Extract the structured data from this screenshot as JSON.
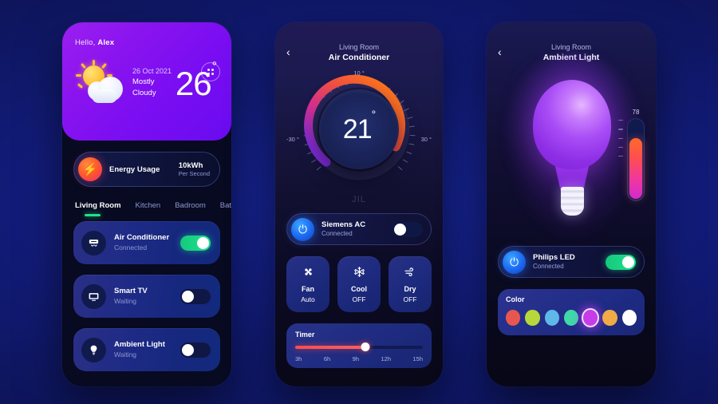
{
  "theme": {
    "background": "#121c7a",
    "accent_green": "#1fe08e",
    "accent_purple": "#8a14ef",
    "accent_blue": "#1e6ff5",
    "accent_red": "#ff4d4d"
  },
  "screen1": {
    "greeting_prefix": "Hello, ",
    "greeting_name": "Alex",
    "grid_button": "grid-menu",
    "weather": {
      "date": "26 Oct 2021",
      "condition_line1": "Mostly",
      "condition_line2": "Cloudy",
      "temperature": "26",
      "degree": "°",
      "icon": "sun-behind-cloud-icon"
    },
    "energy": {
      "label": "Energy Usage",
      "value": "10kWh",
      "unit": "Per Second",
      "icon": "bolt-icon"
    },
    "tabs": [
      {
        "label": "Living Room",
        "active": true
      },
      {
        "label": "Kitchen",
        "active": false
      },
      {
        "label": "Badroom",
        "active": false
      },
      {
        "label": "Bath",
        "active": false
      }
    ],
    "devices": [
      {
        "name": "Air Conditioner",
        "status": "Connected",
        "icon": "air-conditioner-icon",
        "toggle": "on"
      },
      {
        "name": "Smart TV",
        "status": "Waiting",
        "icon": "television-icon",
        "toggle": "off"
      },
      {
        "name": "Ambient Light",
        "status": "Waiting",
        "icon": "lightbulb-icon",
        "toggle": "off"
      }
    ]
  },
  "screen2": {
    "back": "‹",
    "room": "Living Room",
    "device": "Air Conditioner",
    "thermostat": {
      "top_label": "10 °",
      "left_label": "-30 °",
      "right_label": "30 °",
      "value": "21",
      "degree": "°",
      "brand": "JIL"
    },
    "power_card": {
      "name": "Siemens AC",
      "status": "Connected",
      "icon": "power-icon",
      "toggle": "off"
    },
    "modes": [
      {
        "label": "Fan",
        "value": "Auto",
        "icon": "fan-icon",
        "glyph": "✻",
        "active": true
      },
      {
        "label": "Cool",
        "value": "OFF",
        "icon": "snowflake-icon",
        "glyph": "❄",
        "active": false
      },
      {
        "label": "Dry",
        "value": "OFF",
        "icon": "wind-icon",
        "glyph": "⟿",
        "active": false
      }
    ],
    "timer": {
      "title": "Timer",
      "ticks": [
        "3h",
        "6h",
        "9h",
        "12h",
        "15h"
      ],
      "value_percent": 55
    }
  },
  "screen3": {
    "back": "‹",
    "room": "Living Room",
    "device": "Ambient Light",
    "bulb_icon": "glowing-lightbulb-icon",
    "brightness": {
      "value": "78",
      "percent": 78
    },
    "power_card": {
      "name": "Philips LED",
      "status": "Connected",
      "icon": "power-icon",
      "toggle": "on"
    },
    "color": {
      "title": "Color",
      "swatches": [
        {
          "hex": "#e8574f",
          "selected": false
        },
        {
          "hex": "#b7d83a",
          "selected": false
        },
        {
          "hex": "#5fb8e8",
          "selected": false
        },
        {
          "hex": "#3fd9a8",
          "selected": false
        },
        {
          "hex": "#c63ce8",
          "selected": true
        },
        {
          "hex": "#f0aa46",
          "selected": false
        },
        {
          "hex": "#ffffff",
          "selected": false
        }
      ]
    }
  }
}
